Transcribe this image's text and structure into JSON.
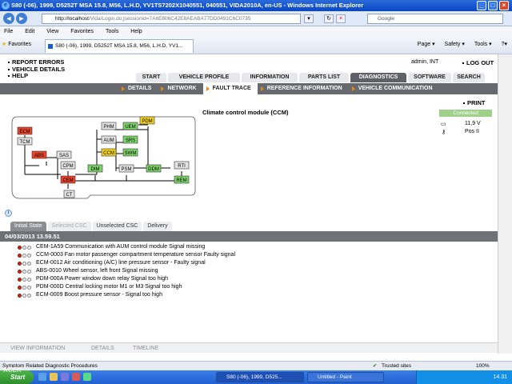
{
  "window": {
    "title": "S80 (-06), 1999, D5252T MSA 15.8, M56, L.H.D, YV1TS7202X1040551, 040551, VIDA2010A, en-US - Windows Internet Explorer"
  },
  "browser": {
    "url_host": "http://localhost",
    "url_path": "/Vida/Login.do;jsessionid=7A6E806C42E8AEABA77DD0491C6C0735",
    "search_placeholder": "Google",
    "menu": [
      "File",
      "Edit",
      "View",
      "Favorites",
      "Tools",
      "Help"
    ],
    "favorites_label": "Favorites",
    "tab_title": "S80 (-06), 1999, D5252T MSA 15.8, M56, L.H.D, YV1...",
    "tools": [
      "Page ▾",
      "Safety ▾",
      "Tools ▾",
      "?▾"
    ]
  },
  "app": {
    "nav_links": [
      "REPORT ERRORS",
      "VEHICLE DETAILS",
      "HELP"
    ],
    "user": "admin, INT",
    "logout": "LOG OUT",
    "main_tabs": [
      {
        "label": "START",
        "active": false
      },
      {
        "label": "VEHICLE PROFILE",
        "active": false
      },
      {
        "label": "INFORMATION",
        "active": false
      },
      {
        "label": "PARTS LIST",
        "active": false
      },
      {
        "label": "DIAGNOSTICS",
        "active": true
      },
      {
        "label": "SOFTWARE",
        "active": false
      },
      {
        "label": "SEARCH",
        "active": false
      }
    ],
    "sub_tabs": [
      {
        "label": "DETAILS",
        "active": false
      },
      {
        "label": "NETWORK",
        "active": false
      },
      {
        "label": "FAULT TRACE",
        "active": true
      },
      {
        "label": "REFERENCE INFORMATION",
        "active": false
      },
      {
        "label": "VEHICLE COMMUNICATION",
        "active": false
      }
    ],
    "module_title": "Climate control module (CCM)",
    "print": "PRINT",
    "status": {
      "connected": "Connected",
      "voltage": "11,9 V",
      "ignition": "Pos II"
    },
    "network_modules": [
      {
        "label": "ECM",
        "status": "red"
      },
      {
        "label": "TCM",
        "status": "grey"
      },
      {
        "label": "ABS",
        "status": "red"
      },
      {
        "label": "SAS",
        "status": "grey"
      },
      {
        "label": "CPM",
        "status": "grey"
      },
      {
        "label": "CEM",
        "status": "red"
      },
      {
        "label": "CT",
        "status": "grey"
      },
      {
        "label": "PHM",
        "status": "grey"
      },
      {
        "label": "AUM",
        "status": "grey"
      },
      {
        "label": "CCM",
        "status": "yellow"
      },
      {
        "label": "UEM",
        "status": "green"
      },
      {
        "label": "SRS",
        "status": "green"
      },
      {
        "label": "SWM",
        "status": "green"
      },
      {
        "label": "PDM",
        "status": "yellow"
      },
      {
        "label": "DIM",
        "status": "green"
      },
      {
        "label": "PSM",
        "status": "grey"
      },
      {
        "label": "DDM",
        "status": "green"
      },
      {
        "label": "RTI",
        "status": "grey"
      },
      {
        "label": "REM",
        "status": "green"
      }
    ],
    "fault_tabs": [
      {
        "label": "Initial State",
        "state": "active"
      },
      {
        "label": "Selected CSC",
        "state": "disabled"
      },
      {
        "label": "Unselected CSC",
        "state": "normal"
      },
      {
        "label": "Delivery",
        "state": "normal"
      }
    ],
    "timestamp": "04/03/2013 13.59.51",
    "faults": [
      "CEM-1A59 Communication with AUM control module Signal missing",
      "CCM-0003 Fan motor passenger compartment temperature sensor Faulty signal",
      "ECM-0012 Air conditioning (A/C) line pressure sensor - Faulty signal",
      "ABS-0010 Wheel sensor, left front Signal missing",
      "PDM-000A Power window down relay Signal too high",
      "PDM-000D Central locking motor M1 or M3 Signal too high",
      "ECM-0009 Boost pressure sensor - Signal too high"
    ],
    "bottom_tabs": [
      "VIEW INFORMATION",
      "DETAILS",
      "TIMELINE"
    ]
  },
  "statusbar": {
    "left": "Symptom Related Diagnostic Procedures",
    "zone": "Trusted sites",
    "zoom": "100%"
  },
  "taskbar": {
    "start": "Start",
    "tasks": [
      "S80 (-06), 1999, D525...",
      "Untitled - Paint"
    ],
    "clock": "14.31",
    "overlay": "ACER"
  },
  "colors": {
    "red": "#e8442a",
    "yellow": "#f2d21c",
    "green": "#7ed36b",
    "grey": "#e4e4e4",
    "accent": "#e38a1c"
  }
}
